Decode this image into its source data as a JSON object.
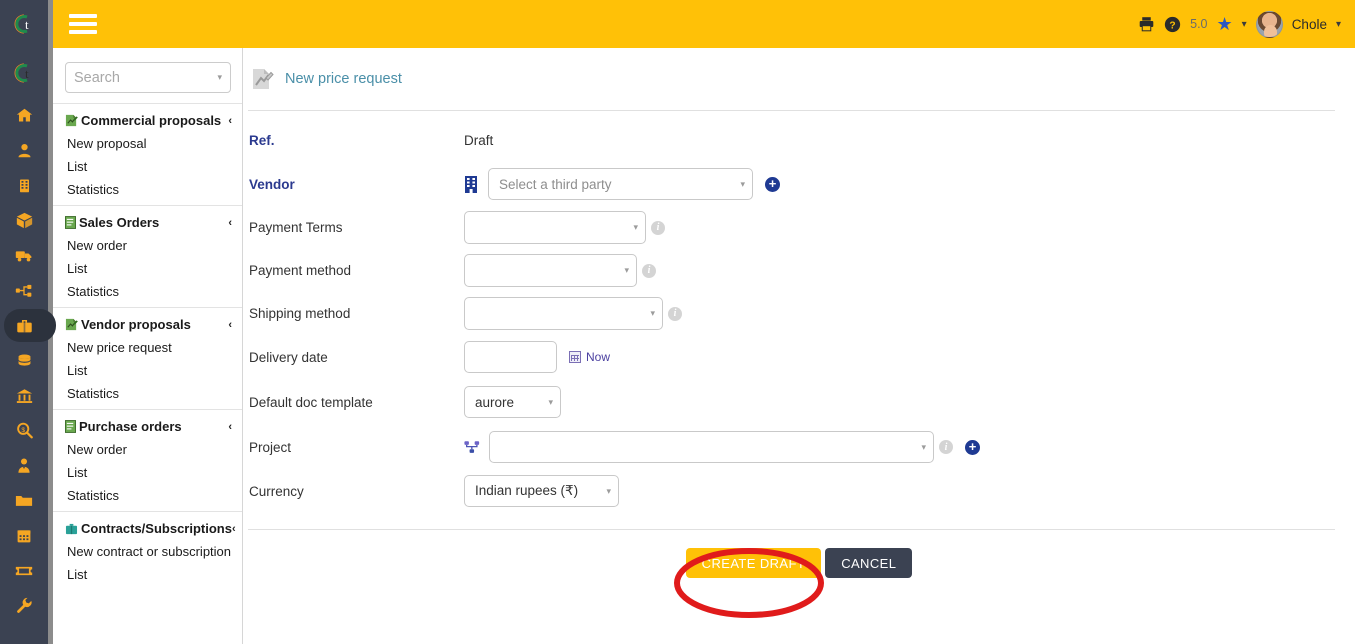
{
  "topbar": {
    "menu_toggle": "hamburger-menu",
    "version": "5.0",
    "username": "Chole",
    "icons": [
      "printer-icon",
      "help-icon",
      "star-icon",
      "chevron-down-icon",
      "avatar",
      "chevron-down-icon"
    ]
  },
  "rail": {
    "logo_letter": "t",
    "items": [
      {
        "name": "home-icon"
      },
      {
        "name": "user-icon"
      },
      {
        "name": "building-icon"
      },
      {
        "name": "product-box-icon"
      },
      {
        "name": "truck-icon"
      },
      {
        "name": "project-network-icon"
      },
      {
        "name": "briefcase-icon",
        "active": true
      },
      {
        "name": "coins-icon"
      },
      {
        "name": "bank-icon"
      },
      {
        "name": "accounting-search-icon"
      },
      {
        "name": "hr-user-icon"
      },
      {
        "name": "folder-icon"
      },
      {
        "name": "calendar-icon"
      },
      {
        "name": "ticket-icon"
      },
      {
        "name": "wrench-icon"
      }
    ]
  },
  "sidebar": {
    "search": {
      "placeholder": "Search"
    },
    "groups": [
      {
        "title": "Commercial proposals",
        "icon": "proposal-icon",
        "collapse": "‹",
        "items": [
          "New proposal",
          "List",
          "Statistics"
        ]
      },
      {
        "title": "Sales Orders",
        "icon": "order-icon",
        "collapse": "‹",
        "items": [
          "New order",
          "List",
          "Statistics"
        ]
      },
      {
        "title": "Vendor proposals",
        "icon": "proposal-icon",
        "collapse": "‹",
        "items": [
          "New price request",
          "List",
          "Statistics"
        ]
      },
      {
        "title": "Purchase orders",
        "icon": "order-icon",
        "collapse": "‹",
        "items": [
          "New order",
          "List",
          "Statistics"
        ]
      },
      {
        "title": "Contracts/Subscriptions",
        "icon": "contract-icon",
        "collapse": "‹",
        "items": [
          "New contract or subscription",
          "List"
        ]
      }
    ]
  },
  "page": {
    "title": "New price request",
    "title_icon": "new-document-icon"
  },
  "form": {
    "ref": {
      "label": "Ref.",
      "value": "Draft"
    },
    "vendor": {
      "label": "Vendor",
      "icon": "company-building-icon",
      "value": "Select a third party",
      "add": "+"
    },
    "payment_terms": {
      "label": "Payment Terms",
      "value": "",
      "info": "i"
    },
    "payment_method": {
      "label": "Payment method",
      "value": "",
      "info": "i"
    },
    "shipping_method": {
      "label": "Shipping method",
      "value": "",
      "info": "i"
    },
    "delivery_date": {
      "label": "Delivery date",
      "value": "",
      "now_label": "Now",
      "now_icon": "calendar-icon"
    },
    "doc_template": {
      "label": "Default doc template",
      "value": "aurore"
    },
    "project": {
      "label": "Project",
      "icon": "project-icon",
      "value": "",
      "info": "i",
      "add": "+"
    },
    "currency": {
      "label": "Currency",
      "value": "Indian rupees (₹)"
    }
  },
  "actions": {
    "create": "CREATE DRAFT",
    "cancel": "CANCEL"
  },
  "annotation": {
    "shape": "red-ellipse-highlight",
    "color": "#e01b1b",
    "target": "CREATE DRAFT"
  },
  "colors": {
    "brand_amber": "#FFC107",
    "rail_dark": "#3b4252",
    "required_label": "#2b3a8f",
    "title_teal": "#4a8fa8",
    "annotation_red": "#e01b1b"
  }
}
